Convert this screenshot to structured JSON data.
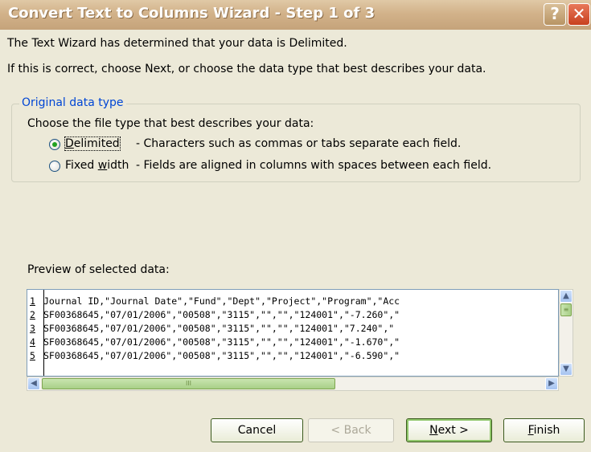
{
  "window": {
    "title": "Convert Text to Columns Wizard - Step 1 of 3",
    "help_glyph": "?",
    "close_glyph": "✕"
  },
  "intro": {
    "line1": "The Text Wizard has determined that your data is Delimited.",
    "line2": "If this is correct, choose Next, or choose the data type that best describes your data."
  },
  "original_data_type": {
    "legend": "Original data type",
    "prompt": "Choose the file type that best describes your data:",
    "options": [
      {
        "label_pre": "",
        "label_key": "D",
        "label_post": "elimited",
        "description": "- Characters such as commas or tabs separate each field.",
        "selected": true
      },
      {
        "label_pre": "Fixed ",
        "label_key": "w",
        "label_post": "idth",
        "description": "- Fields are aligned in columns with spaces between each field.",
        "selected": false
      }
    ]
  },
  "preview": {
    "label": "Preview of selected data:",
    "rows": [
      {
        "num": "1",
        "text": "Journal ID,\"Journal Date\",\"Fund\",\"Dept\",\"Project\",\"Program\",\"Acc"
      },
      {
        "num": "2",
        "text": "SF00368645,\"07/01/2006\",\"00508\",\"3115\",\"\",\"\",\"124001\",\"-7.260\",\""
      },
      {
        "num": "3",
        "text": "SF00368645,\"07/01/2006\",\"00508\",\"3115\",\"\",\"\",\"124001\",\"7.240\",\""
      },
      {
        "num": "4",
        "text": "SF00368645,\"07/01/2006\",\"00508\",\"3115\",\"\",\"\",\"124001\",\"-1.670\",\""
      },
      {
        "num": "5",
        "text": "SF00368645,\"07/01/2006\",\"00508\",\"3115\",\"\",\"\",\"124001\",\"-6.590\",\""
      }
    ],
    "scroll_up": "▲",
    "scroll_down": "▼",
    "scroll_left": "◀",
    "scroll_right": "▶",
    "grip": "III"
  },
  "buttons": {
    "cancel": "Cancel",
    "back": "< Back",
    "next_key": "N",
    "next_rest": "ext >",
    "finish_key": "F",
    "finish_rest": "inish"
  }
}
